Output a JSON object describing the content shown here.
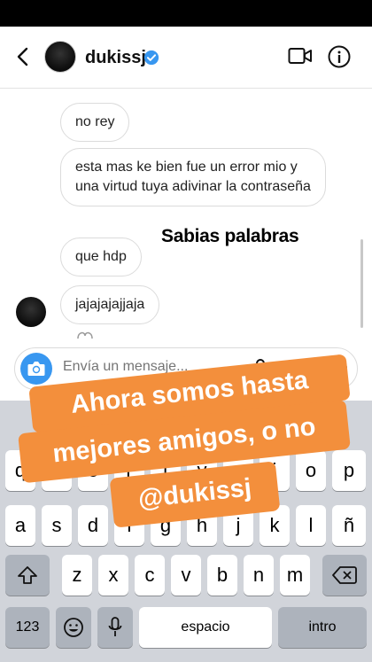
{
  "header": {
    "username": "dukissj"
  },
  "chat": {
    "messages": [
      "no rey",
      "esta mas ke bien fue un error mio y una virtud tuya adivinar la contraseña",
      "que hdp",
      "jajajajajjaja"
    ],
    "sticker_text": "Sabias palabras"
  },
  "composer": {
    "placeholder": "Envía un mensaje..."
  },
  "keyboard": {
    "row1": [
      "q",
      "w",
      "e",
      "r",
      "t",
      "y",
      "u",
      "i",
      "o",
      "p"
    ],
    "row2": [
      "a",
      "s",
      "d",
      "f",
      "g",
      "h",
      "j",
      "k",
      "l",
      "ñ"
    ],
    "row3": [
      "z",
      "x",
      "c",
      "v",
      "b",
      "n",
      "m"
    ],
    "numbers_label": "123",
    "space_label": "espacio",
    "return_label": "intro"
  },
  "overlay": {
    "line1": "Ahora somos hasta",
    "line2": "mejores amigos, o no",
    "line3": "@dukissj",
    "color": "#f38f3c"
  },
  "colors": {
    "accent": "#3897f0",
    "keyboard_bg": "#d1d4da"
  }
}
